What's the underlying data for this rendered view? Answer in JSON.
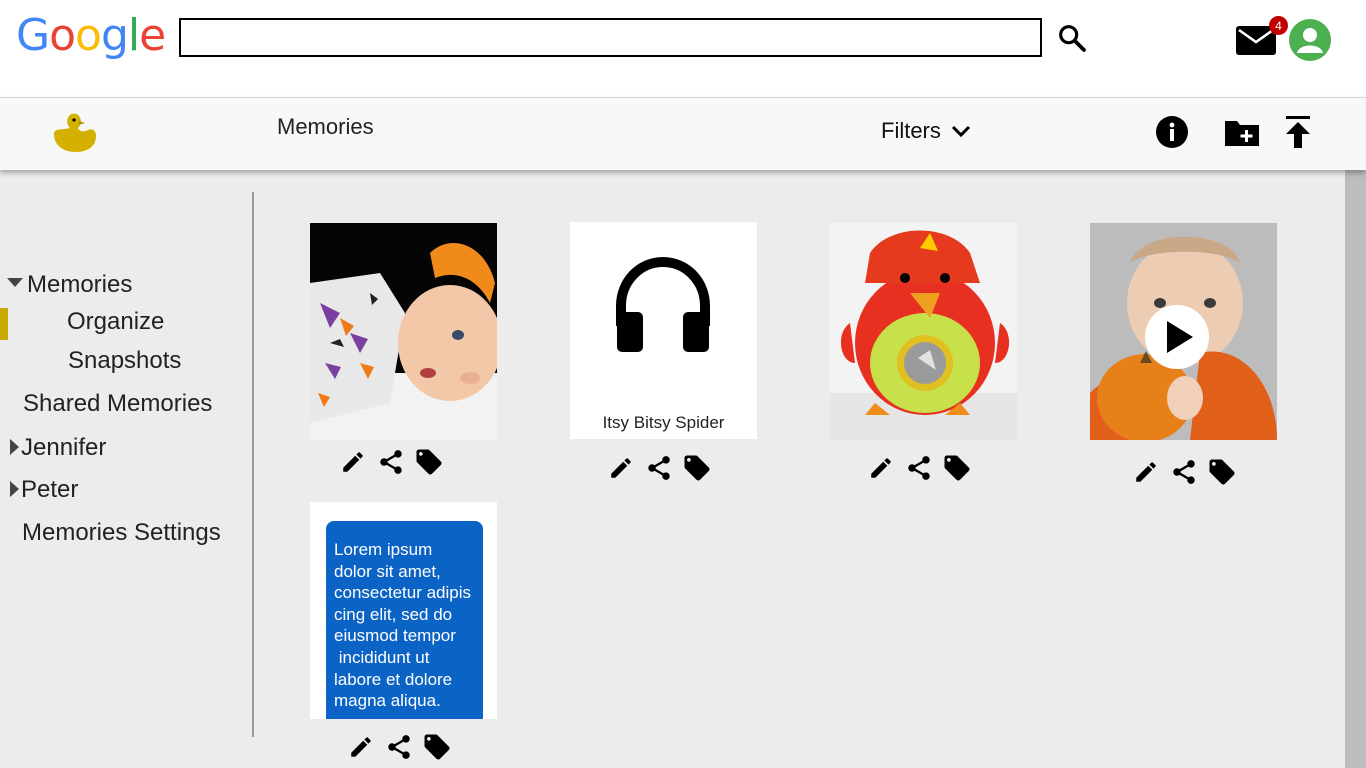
{
  "brand": {
    "logo_letters": [
      "G",
      "o",
      "o",
      "g",
      "l",
      "e"
    ]
  },
  "search": {
    "value": "",
    "placeholder": ""
  },
  "mail": {
    "unread_count": "4"
  },
  "toolbar": {
    "title": "Memories",
    "filters_label": "Filters"
  },
  "sidebar": {
    "items": [
      {
        "label": "Memories",
        "expanded": true
      },
      {
        "label": "Organize",
        "active": true
      },
      {
        "label": "Snapshots"
      },
      {
        "label": "Shared Memories"
      },
      {
        "label": "Jennifer",
        "collapsed": true
      },
      {
        "label": "Peter",
        "collapsed": true
      },
      {
        "label": "Memories Settings"
      }
    ]
  },
  "cards": [
    {
      "type": "photo",
      "subject": "baby lying on blanket"
    },
    {
      "type": "audio",
      "caption": "Itsy Bitsy Spider",
      "icon": "headphones-icon"
    },
    {
      "type": "photo",
      "subject": "red bird plush toy"
    },
    {
      "type": "video",
      "subject": "baby holding pumpkin",
      "icon": "play-icon"
    },
    {
      "type": "note",
      "text": "Lorem ipsum\ndolor sit amet,\nconsectetur adipis\ncing elit, sed do\neiusmod tempor\n incididunt ut\nlabore et dolore\nmagna aliqua."
    }
  ],
  "card_actions": [
    "pencil-icon",
    "share-icon",
    "tag-icon"
  ],
  "colors": {
    "accent_active": "#c9a800",
    "note_bg": "#0b63c5",
    "badge": "#c00000",
    "avatar": "#4CAF50",
    "duck": "#d4b000"
  }
}
